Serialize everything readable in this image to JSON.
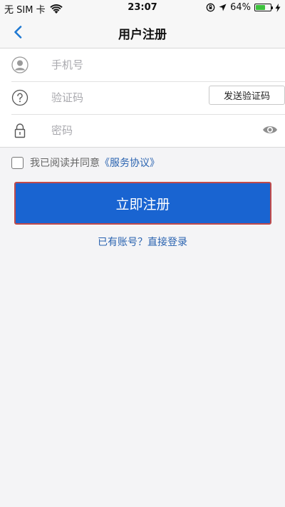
{
  "status_bar": {
    "carrier": "无 SIM 卡",
    "time": "23:07",
    "battery_percent": "64%",
    "battery_level": 0.64
  },
  "nav": {
    "title": "用户注册",
    "back_icon": "chevron-left-icon"
  },
  "form": {
    "phone_placeholder": "手机号",
    "code_placeholder": "验证码",
    "send_code_label": "发送验证码",
    "password_placeholder": "密码"
  },
  "agreement": {
    "text": "我已阅读并同意",
    "link": "《服务协议》",
    "checked": false
  },
  "register_label": "立即注册",
  "login_link": "已有账号？直接登录",
  "colors": {
    "primary": "#1964d1",
    "link": "#2a63b0",
    "button_border": "#c04a4a",
    "battery": "#3cc23c"
  }
}
